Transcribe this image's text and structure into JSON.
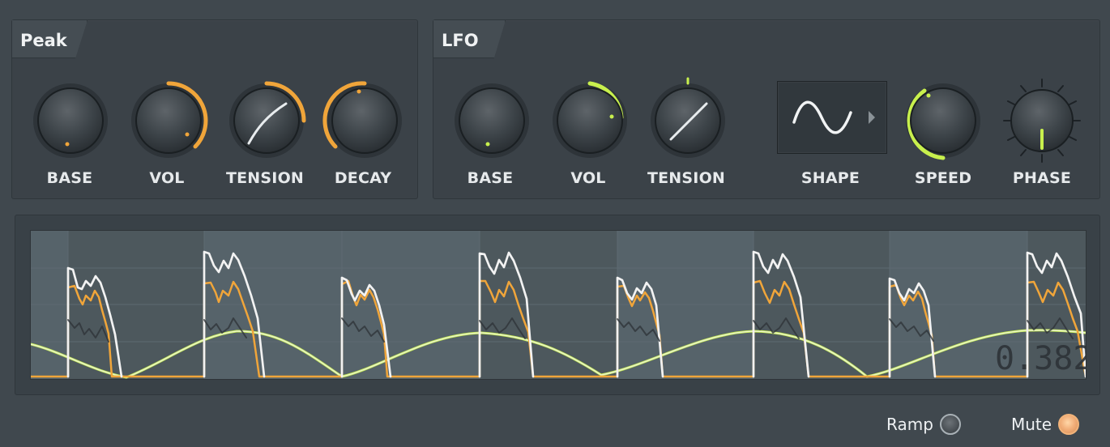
{
  "panels": {
    "peak": {
      "title": "Peak",
      "knobs": [
        {
          "label": "BASE",
          "icon": "knob-icon"
        },
        {
          "label": "VOL",
          "icon": "knob-icon"
        },
        {
          "label": "TENSION",
          "icon": "knob-icon"
        },
        {
          "label": "DECAY",
          "icon": "knob-icon"
        }
      ]
    },
    "lfo": {
      "title": "LFO",
      "knobs": [
        {
          "label": "BASE",
          "icon": "knob-icon"
        },
        {
          "label": "VOL",
          "icon": "knob-icon"
        },
        {
          "label": "TENSION",
          "icon": "knob-icon"
        },
        {
          "label": "SPEED",
          "icon": "knob-icon"
        },
        {
          "label": "PHASE",
          "icon": "knob-icon"
        }
      ],
      "shape": {
        "label": "SHAPE",
        "icon": "sine-wave-icon",
        "arrow_icon": "chevron-right-icon"
      }
    }
  },
  "graph": {
    "value_label": "0.382"
  },
  "footer": {
    "ramp_label": "Ramp",
    "mute_label": "Mute"
  },
  "colors": {
    "accent_orange": "#f0a53a",
    "accent_green": "#c8f04d",
    "signal_white": "#f2f2f2"
  }
}
